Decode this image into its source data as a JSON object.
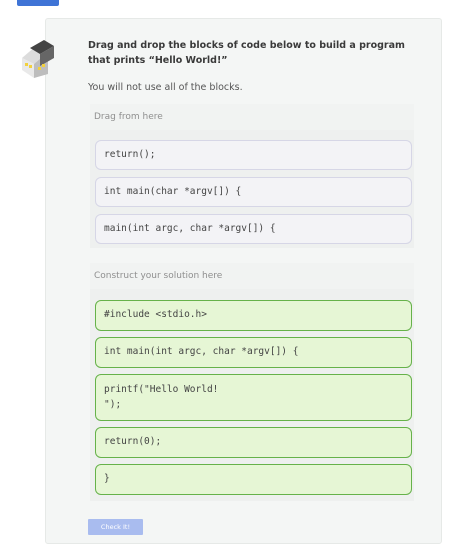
{
  "prompt": {
    "title": "Drag and drop the blocks of code below to build a program that prints “Hello World!”",
    "note": "You will not use all of the blocks."
  },
  "source": {
    "label": "Drag from here",
    "blocks": [
      "return();",
      "int main(char *argv[]) {",
      "main(int argc, char *argv[]) {"
    ]
  },
  "solution": {
    "label": "Construct your solution here",
    "blocks": [
      "#include <stdio.h>",
      "int main(int argc, char *argv[]) {",
      "printf(\"Hello World!\n\");",
      "return(0);",
      "}"
    ]
  },
  "check_button": "Check It!",
  "colors": {
    "accent": "#3f74d6",
    "button": "#a9bcef",
    "solution_block_border": "#66b24a",
    "solution_block_bg": "#e6f6d5"
  },
  "icons": {
    "avatar": "codio-building-icon"
  }
}
